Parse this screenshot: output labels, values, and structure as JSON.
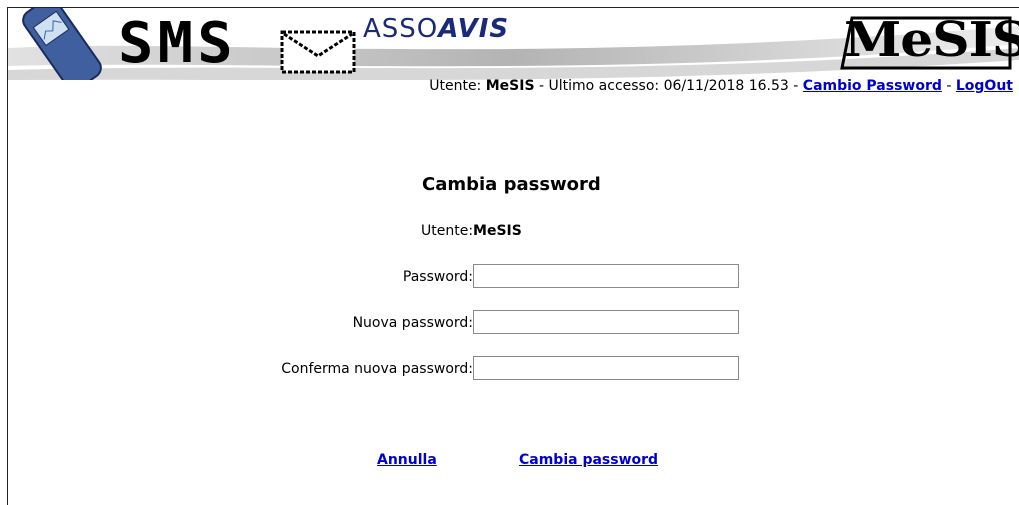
{
  "banner": {
    "sms_text": "SMS",
    "asso_prefix": "ASSO",
    "avis_text": "AVIS",
    "mesis_logo": "MeSIS",
    "icons": [
      "phone-icon",
      "envelope-icon"
    ]
  },
  "userbar": {
    "user_label": "Utente:",
    "user_name": "MeSIS",
    "last_access_label": "- Ultimo accesso:",
    "last_access_value": "06/11/2018 16.53",
    "sep1": "-",
    "change_password_link": "Cambio Password",
    "sep2": "-",
    "logout_link": "LogOut"
  },
  "form": {
    "title": "Cambia password",
    "user_label": "Utente:",
    "user_value": "MeSIS",
    "password_label": "Password:",
    "password_value": "",
    "new_password_label": "Nuova password:",
    "new_password_value": "",
    "confirm_password_label": "Conferma nuova password:",
    "confirm_password_value": "",
    "cancel_link": "Annulla",
    "submit_link": "Cambia password"
  },
  "colors": {
    "link": "#0000cc",
    "logo_blue": "#1a2a7a",
    "border": "#8a8a8a"
  }
}
